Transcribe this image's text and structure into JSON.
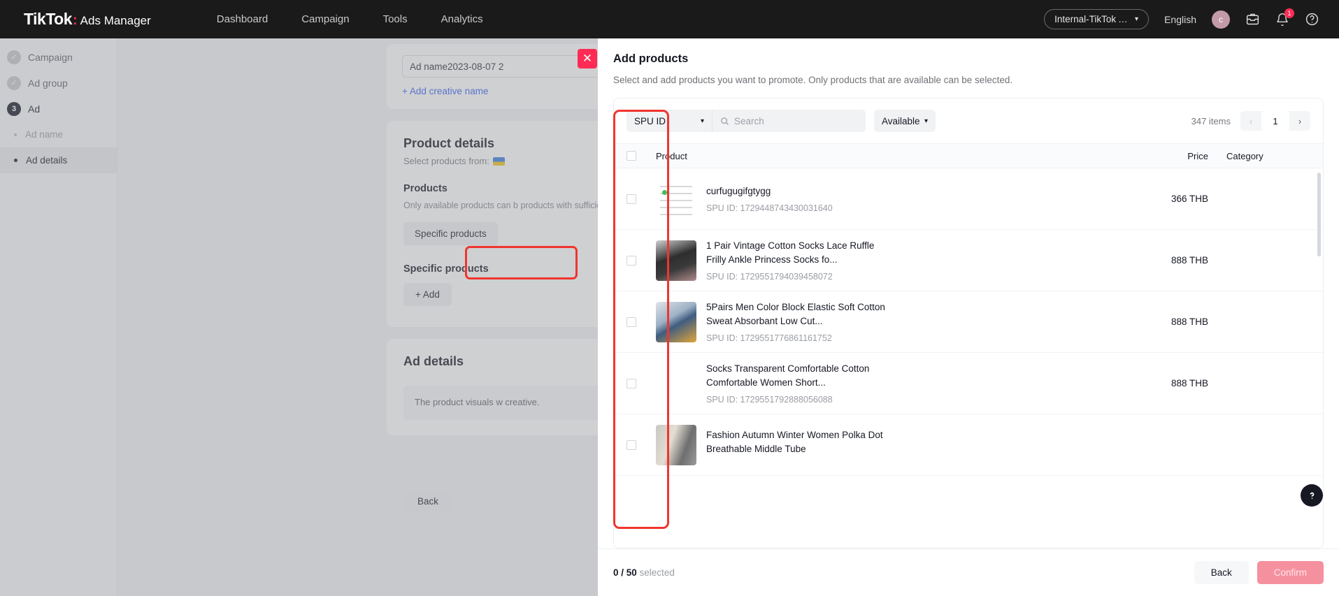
{
  "topnav": {
    "brand_main": "TikTok",
    "brand_dots": ":",
    "brand_sub": "Ads Manager",
    "links": [
      "Dashboard",
      "Campaign",
      "Tools",
      "Analytics"
    ],
    "account": "Internal-TikTok Ads Int...",
    "language": "English",
    "avatar_initial": "c",
    "notification_badge": "1"
  },
  "sidebar": {
    "steps": [
      {
        "marker": "✓",
        "label": "Campaign",
        "state": "done"
      },
      {
        "marker": "✓",
        "label": "Ad group",
        "state": "done"
      },
      {
        "marker": "3",
        "label": "Ad",
        "state": "active"
      }
    ],
    "subitems": [
      {
        "label": "Ad name",
        "selected": false
      },
      {
        "label": "Ad details",
        "selected": true
      }
    ]
  },
  "background": {
    "ad_name_value": "Ad name2023-08-07 2",
    "add_creative_name": "+ Add creative name",
    "product_details_title": "Product details",
    "select_products_from": "Select products from:",
    "products_label": "Products",
    "products_desc": "Only available products can b products with sufficient inven",
    "specific_products_button": "Specific products",
    "specific_products_heading": "Specific products",
    "add_button": "+ Add",
    "ad_details_title": "Ad details",
    "ad_details_notice": "The product visuals w creative.",
    "back_button": "Back"
  },
  "modal": {
    "title": "Add products",
    "description": "Select and add products you want to promote. Only products that are available can be selected.",
    "close_label": "✕",
    "toolbar": {
      "spu_select": "SPU ID",
      "search_placeholder": "Search",
      "search_value": "",
      "availability_select": "Available",
      "items_count": "347 items",
      "page_prev": "‹",
      "page_current": "1",
      "page_next": "›"
    },
    "table": {
      "columns": [
        "Product",
        "Price",
        "Category"
      ],
      "rows": [
        {
          "name": "curfugugifgtygg",
          "spu_label": "SPU ID: 1729448743430031640",
          "price": "366 THB",
          "category": "",
          "thumb": "t1"
        },
        {
          "name": "1 Pair Vintage Cotton Socks Lace Ruffle Frilly Ankle Princess Socks fo...",
          "spu_label": "SPU ID: 1729551794039458072",
          "price": "888 THB",
          "category": "",
          "thumb": "t2"
        },
        {
          "name": "5Pairs Men Color Block Elastic Soft Cotton Sweat Absorbant Low Cut...",
          "spu_label": "SPU ID: 1729551776861161752",
          "price": "888 THB",
          "category": "",
          "thumb": "t3"
        },
        {
          "name": "Socks Transparent Comfortable Cotton Comfortable Women Short...",
          "spu_label": "SPU ID: 1729551792888056088",
          "price": "888 THB",
          "category": "",
          "thumb": "t4"
        },
        {
          "name": "Fashion Autumn Winter Women Polka Dot Breathable Middle Tube",
          "spu_label": "",
          "price": "",
          "category": "",
          "thumb": "t5"
        }
      ]
    },
    "footer": {
      "selected_count": "0 / 50",
      "selected_suffix": "selected",
      "back_button": "Back",
      "confirm_button": "Confirm"
    }
  },
  "help": {
    "label": "?"
  },
  "colors": {
    "brand_accent": "#fe2c55",
    "annotation_red": "#f0352f",
    "link_blue": "#3761f5",
    "dark_nav": "#1a1a1a"
  }
}
